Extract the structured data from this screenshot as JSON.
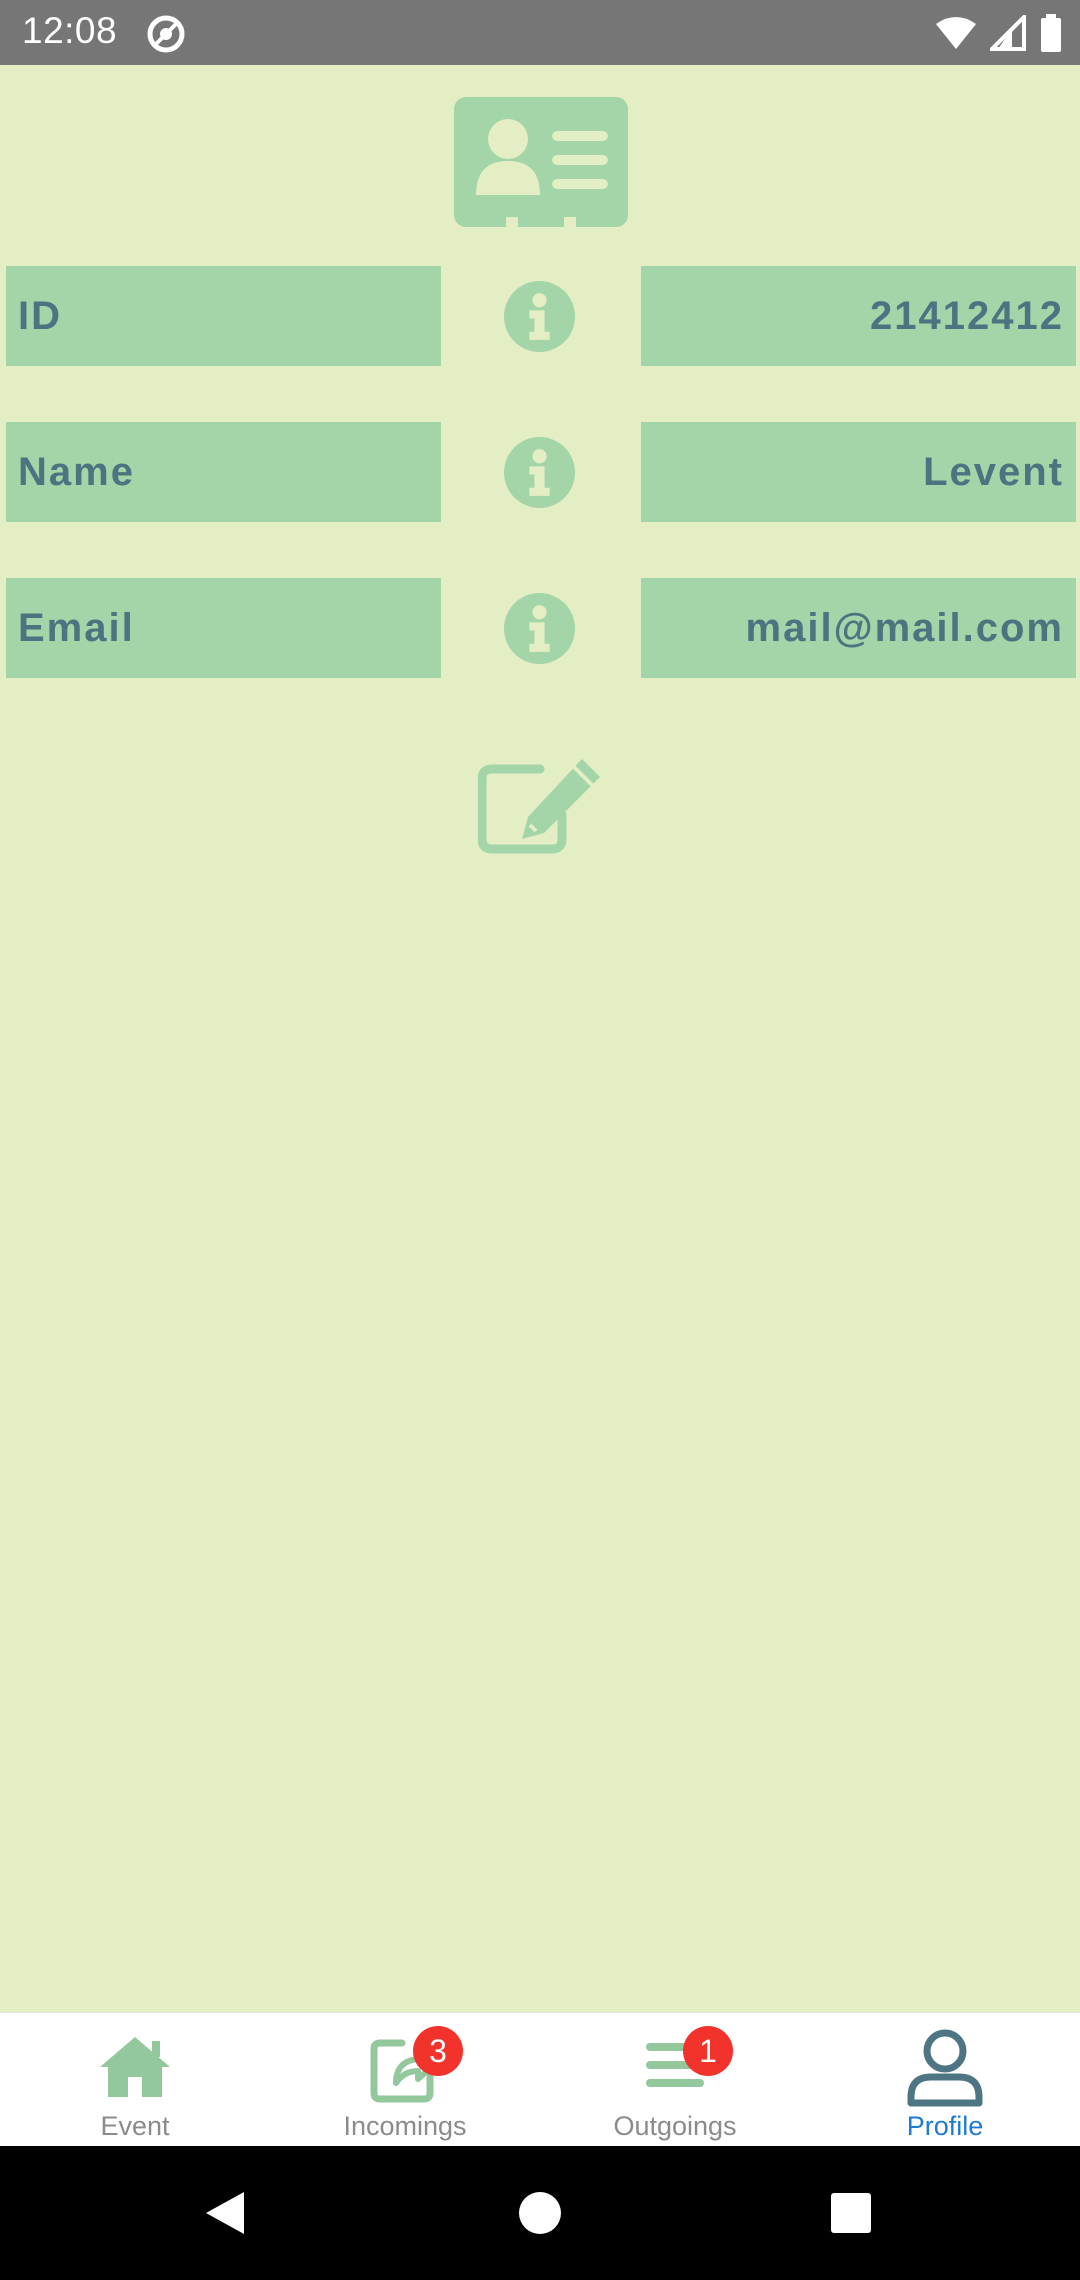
{
  "status_bar": {
    "time": "12:08",
    "icons": [
      "dnd-icon",
      "wifi-icon",
      "signal-icon",
      "battery-icon"
    ]
  },
  "header_icon": "id-card-icon",
  "fields": [
    {
      "label": "ID",
      "value": "21412412",
      "icon": "info-icon"
    },
    {
      "label": "Name",
      "value": "Levent",
      "icon": "info-icon"
    },
    {
      "label": "Email",
      "value": "mail@mail.com",
      "icon": "info-icon"
    }
  ],
  "edit_icon": "edit-icon",
  "tabs": [
    {
      "label": "Event",
      "icon": "home-icon",
      "active": false
    },
    {
      "label": "Incomings",
      "icon": "incoming-share-icon",
      "badge": "3",
      "active": false
    },
    {
      "label": "Outgoings",
      "icon": "list-icon",
      "badge": "1",
      "active": false
    },
    {
      "label": "Profile",
      "icon": "user-icon",
      "active": true
    }
  ],
  "colors": {
    "background": "#e4eec4",
    "field_fill": "#a3d5a9",
    "field_text": "#4b7480",
    "active_tab": "#1d7bd6",
    "badge": "#f2332c"
  }
}
